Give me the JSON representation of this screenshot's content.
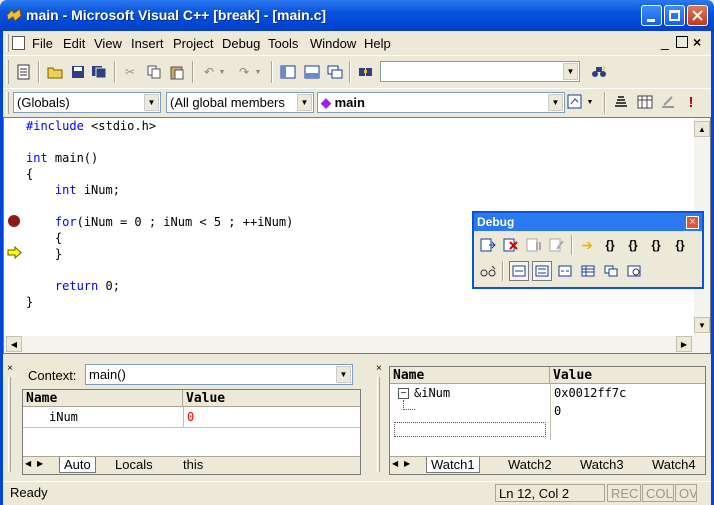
{
  "window": {
    "title": "main - Microsoft Visual C++ [break] - [main.c]"
  },
  "menu": [
    "File",
    "Edit",
    "View",
    "Insert",
    "Project",
    "Debug",
    "Tools",
    "Window",
    "Help"
  ],
  "toolbar": {
    "find_value": ""
  },
  "wizardbar": {
    "class_combo": "(Globals)",
    "filter_combo": "(All global members",
    "member_combo": "main"
  },
  "editor": {
    "lines": [
      "#include <stdio.h>",
      "",
      "int main()",
      "{",
      "    int iNum;",
      "",
      "    for(iNum = 0 ; iNum < 5 ; ++iNum)",
      "    {",
      "    }",
      "",
      "    return 0;",
      "}"
    ]
  },
  "debug_toolbar": {
    "title": "Debug"
  },
  "variables": {
    "context_label": "Context:",
    "context_value": "main()",
    "columns": [
      "Name",
      "Value"
    ],
    "rows": [
      {
        "name": "iNum",
        "value": "0"
      }
    ],
    "tabs": [
      "Auto",
      "Locals",
      "this"
    ]
  },
  "watch": {
    "columns": [
      "Name",
      "Value"
    ],
    "rows": [
      {
        "name": "&iNum",
        "value": "0x0012ff7c"
      },
      {
        "name": "",
        "value": "0"
      }
    ],
    "tabs": [
      "Watch1",
      "Watch2",
      "Watch3",
      "Watch4"
    ]
  },
  "status": {
    "text": "Ready",
    "position": "Ln 12, Col 2",
    "indicators": [
      "REC",
      "COL",
      "OV"
    ]
  },
  "colors": {
    "keyword": "#0000FF",
    "changed_value": "#FF0000",
    "breakpoint": "#8B1A1A",
    "titlebar": "#0A53DB"
  }
}
